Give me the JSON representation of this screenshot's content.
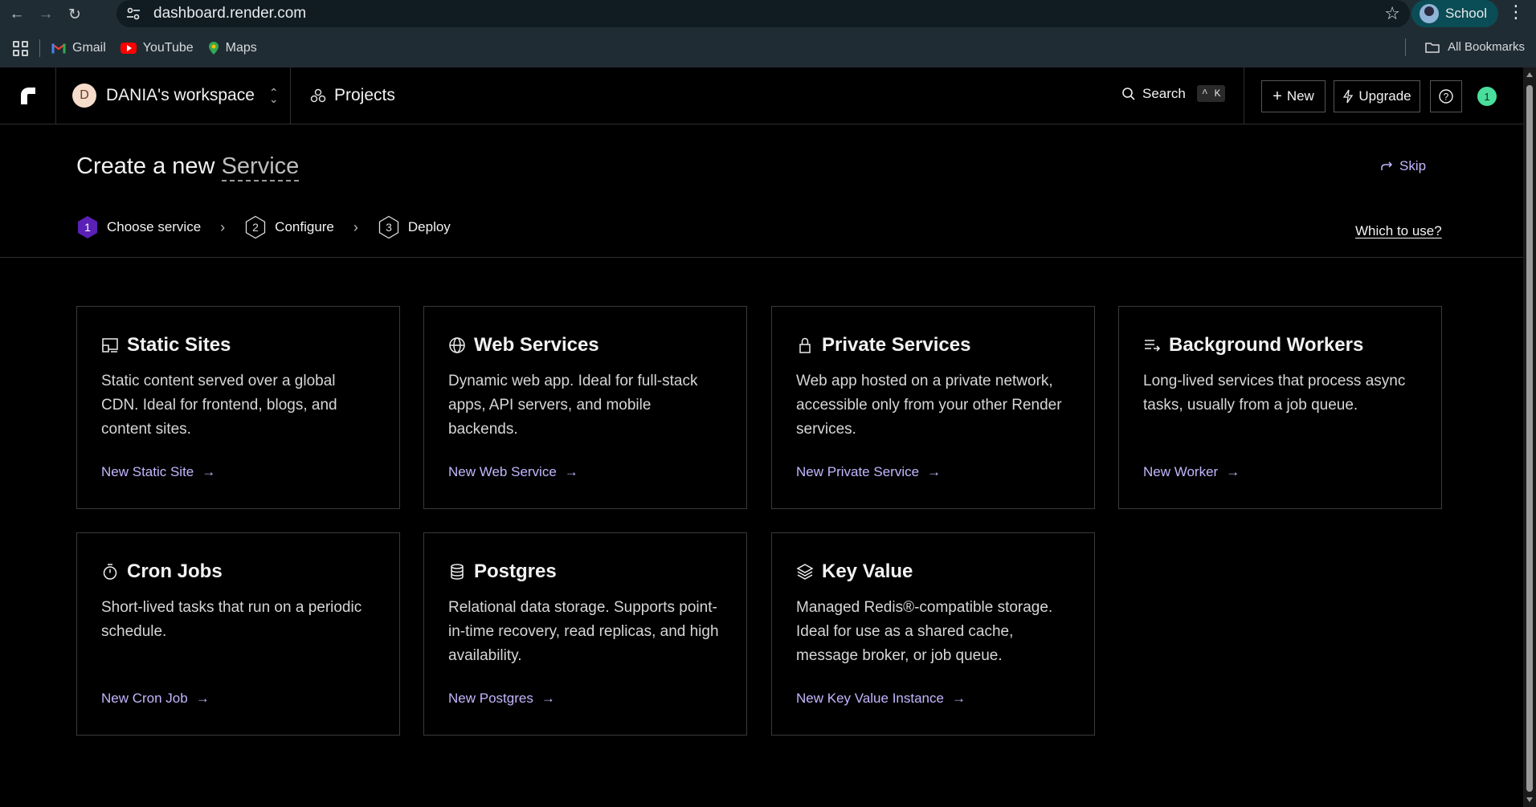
{
  "browser": {
    "url": "dashboard.render.com",
    "profile_label": "School",
    "bookmarks": [
      {
        "label": "Gmail",
        "icon": "gmail-icon"
      },
      {
        "label": "YouTube",
        "icon": "youtube-icon"
      },
      {
        "label": "Maps",
        "icon": "maps-icon"
      }
    ],
    "all_bookmarks_label": "All Bookmarks"
  },
  "header": {
    "workspace_initial": "D",
    "workspace_name": "DANIA's workspace",
    "projects_label": "Projects",
    "search_label": "Search",
    "search_shortcut": "^ K",
    "new_label": "New",
    "upgrade_label": "Upgrade",
    "notification_count": "1"
  },
  "page": {
    "title_prefix": "Create a new",
    "title_highlight": "Service",
    "skip_label": "Skip",
    "which_label": "Which to use?",
    "steps": [
      {
        "number": "1",
        "label": "Choose service"
      },
      {
        "number": "2",
        "label": "Configure"
      },
      {
        "number": "3",
        "label": "Deploy"
      }
    ]
  },
  "services": [
    {
      "title": "Static Sites",
      "icon": "static-site-icon",
      "description": "Static content served over a global CDN. Ideal for frontend, blogs, and content sites.",
      "link": "New Static Site"
    },
    {
      "title": "Web Services",
      "icon": "globe-icon",
      "description": "Dynamic web app. Ideal for full-stack apps, API servers, and mobile backends.",
      "link": "New Web Service"
    },
    {
      "title": "Private Services",
      "icon": "lock-icon",
      "description": "Web app hosted on a private network, accessible only from your other Render services.",
      "link": "New Private Service"
    },
    {
      "title": "Background Workers",
      "icon": "list-arrow-icon",
      "description": "Long-lived services that process async tasks, usually from a job queue.",
      "link": "New Worker"
    },
    {
      "title": "Cron Jobs",
      "icon": "stopwatch-icon",
      "description": "Short-lived tasks that run on a periodic schedule.",
      "link": "New Cron Job"
    },
    {
      "title": "Postgres",
      "icon": "database-icon",
      "description": "Relational data storage. Supports point-in-time recovery, read replicas, and high availability.",
      "link": "New Postgres"
    },
    {
      "title": "Key Value",
      "icon": "layers-icon",
      "description": "Managed Redis®-compatible storage. Ideal for use as a shared cache, message broker, or job queue.",
      "link": "New Key Value Instance"
    }
  ],
  "colors": {
    "accent_link": "#c4b5fd",
    "step_active": "#5b21b6",
    "notification": "#4ade9c"
  }
}
